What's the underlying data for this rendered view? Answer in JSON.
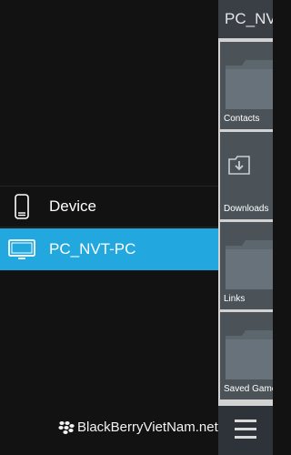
{
  "drawer": {
    "items": [
      {
        "label": "Device",
        "icon": "phone-icon",
        "selected": false
      },
      {
        "label": "PC_NVT-PC",
        "icon": "monitor-icon",
        "selected": true
      }
    ]
  },
  "panel": {
    "title": "PC_NVT-PC",
    "folders": [
      {
        "label": "Contacts",
        "icon": "folder-icon"
      },
      {
        "label": "Downloads",
        "icon": "download-folder-icon"
      },
      {
        "label": "Links",
        "icon": "folder-icon"
      },
      {
        "label": "Saved Games",
        "icon": "folder-icon"
      }
    ]
  },
  "watermark": {
    "text": "BlackBerryVietNam.net"
  },
  "colors": {
    "accent": "#22a7de",
    "background": "#121212",
    "tile": "#4b5358"
  }
}
